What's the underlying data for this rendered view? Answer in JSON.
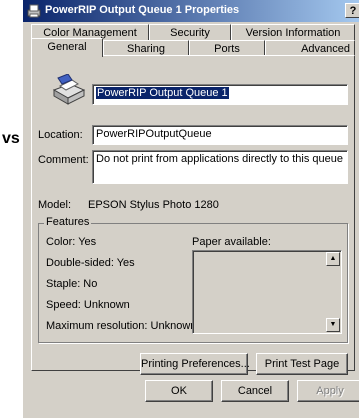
{
  "background_text": "vs",
  "window": {
    "title": "PowerRIP Output Queue 1 Properties",
    "help_label": "?"
  },
  "tabs": {
    "row1": [
      "Color Management",
      "Security",
      "Version Information"
    ],
    "row2": [
      "General",
      "Sharing",
      "Ports",
      "Advanced"
    ],
    "active": "General"
  },
  "general": {
    "printer_name": "PowerRIP Output Queue 1",
    "location_label": "Location:",
    "location_value": "PowerRIPOutputQueue",
    "comment_label": "Comment:",
    "comment_value": "Do not print from applications directly to this queue",
    "model_label": "Model:",
    "model_value": "EPSON Stylus Photo 1280"
  },
  "features": {
    "title": "Features",
    "color": "Color: Yes",
    "double_sided": "Double-sided: Yes",
    "staple": "Staple: No",
    "speed": "Speed: Unknown",
    "max_resolution": "Maximum resolution: Unknown",
    "paper_available_label": "Paper available:"
  },
  "buttons": {
    "printing_preferences": "Printing Preferences...",
    "print_test_page": "Print Test Page",
    "ok": "OK",
    "cancel": "Cancel",
    "apply": "Apply"
  },
  "colors": {
    "title_bar_start": "#0a246a",
    "title_bar_end": "#a6caf0",
    "dialog_face": "#d4d0c8",
    "selection": "#0a246a"
  }
}
